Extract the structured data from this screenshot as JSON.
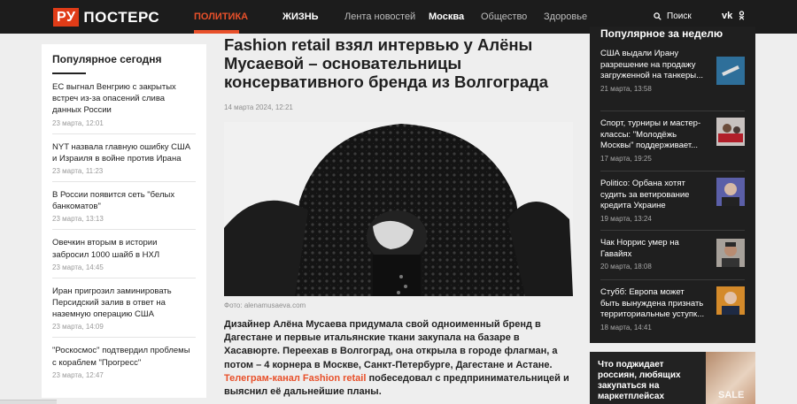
{
  "header": {
    "logo_box": "РУ",
    "logo_text": "ПОСТЕРС",
    "nav": [
      "ПОЛИТИКА",
      "ЖИЗНЬ",
      "Лента новостей",
      "Москва",
      "Общество",
      "Здоровье"
    ],
    "search_label": "Поиск",
    "social": [
      "vk-icon",
      "ok-icon"
    ],
    "accent": "#e8502a"
  },
  "left": {
    "title": "Популярное сегодня",
    "items": [
      {
        "title": "ЕС выгнал Венгрию с закрытых встреч из-за опасений слива данных России",
        "date": "23 марта, 12:01"
      },
      {
        "title": "NYT назвала главную ошибку США и Израиля в войне против Ирана",
        "date": "23 марта, 11:23"
      },
      {
        "title": "В России появится сеть \"белых банкоматов\"",
        "date": "23 марта, 13:13"
      },
      {
        "title": "Овечкин вторым в истории забросил 1000 шайб в НХЛ",
        "date": "23 марта, 14:45"
      },
      {
        "title": "Иран пригрозил заминировать Персидский залив в ответ на наземную операцию США",
        "date": "23 марта, 14:09"
      },
      {
        "title": "\"Роскосмос\" подтвердил проблемы с кораблем \"Прогресс\"",
        "date": "23 марта, 12:47"
      }
    ]
  },
  "article": {
    "headline": "Fashion retail взял интервью у Алёны Мусаевой – основательницы консервативного бренда из Волгограда",
    "date": "14 марта 2024, 12:21",
    "caption": "Фото: alenamusaeva.com",
    "lead_1": "Дизайнер Алёна Мусаева придумала свой одноименный бренд в Дагестане и первые итальянские ткани закупала на базаре в Хасавюрте. Переехав в Волгоград, она открыла в городе флагман, а потом – 4 корнера в Москве, Санкт-Петербурге, Дагестане и Астане. ",
    "lead_link": "Телеграм-канал Fashion retail",
    "lead_2": " побеседовал с предпринимательницей и выяснил её дальнейшие планы."
  },
  "right": {
    "title": "Популярное за неделю",
    "items": [
      {
        "title": "США выдали Ирану разрешение на продажу загруженной на танкеры...",
        "date": "21 марта, 13:58"
      },
      {
        "title": "Спорт, турниры и мастер-классы: \"Молодёжь Москвы\" поддерживает...",
        "date": "17 марта, 19:25"
      },
      {
        "title": "Politico: Орбана хотят судить за ветирование кредита Украине",
        "date": "19 марта, 13:24"
      },
      {
        "title": "Чак Норрис умер на Гавайях",
        "date": "20 марта, 18:08"
      },
      {
        "title": "Стубб: Европа может быть вынуждена признать территориальные уступк...",
        "date": "18 марта, 14:41"
      }
    ]
  },
  "promo": {
    "title": "Что поджидает россиян, любящих закупаться на маркетплейсах",
    "img_text": "SALE"
  }
}
